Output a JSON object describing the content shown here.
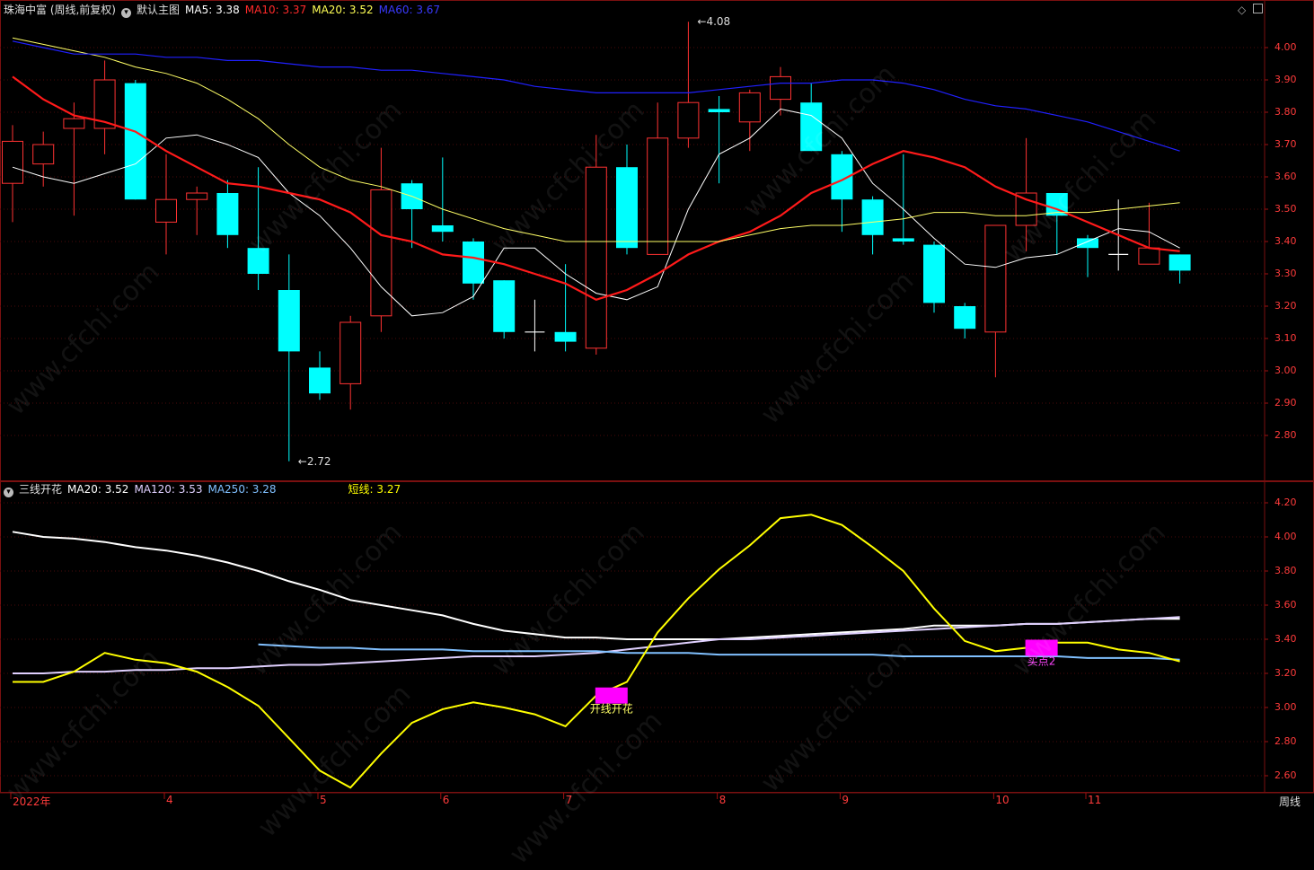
{
  "main_header": {
    "stock": "珠海中富 (周线,前复权)",
    "template": "默认主图",
    "ma5": "MA5: 3.38",
    "ma10": "MA10: 3.37",
    "ma20": "MA20: 3.52",
    "ma60": "MA60: 3.67"
  },
  "sub_header": {
    "name": "三线开花",
    "ma20": "MA20: 3.52",
    "ma120": "MA120: 3.53",
    "ma250": "MA250: 3.28",
    "short": "短线: 3.27"
  },
  "period_label": "周线",
  "colors": {
    "up": "#ff3232",
    "down": "#00ffff",
    "ma5": "#ffffff",
    "ma10": "#ff1a1a",
    "ma20": "#ffff66",
    "ma60": "#2020ff",
    "ind_ma20": "#ffffff",
    "ind_ma120": "#e0d0ff",
    "ind_ma250": "#80c0ff",
    "short": "#ffff00",
    "signal": "#ff00ff"
  },
  "watermark": "www.cfchi.com",
  "chart_data": [
    {
      "type": "candlestick",
      "title": "珠海中富 (周线,前复权)",
      "ylim": [
        2.65,
        4.15
      ],
      "yticks": [
        4.0,
        3.9,
        3.8,
        3.7,
        3.6,
        3.5,
        3.4,
        3.3,
        3.2,
        3.1,
        3.0,
        2.9,
        2.8
      ],
      "max_label": "4.08",
      "min_label": "2.72",
      "candles": [
        {
          "o": 3.58,
          "c": 3.71,
          "h": 3.76,
          "l": 3.46
        },
        {
          "o": 3.64,
          "c": 3.7,
          "h": 3.74,
          "l": 3.57
        },
        {
          "o": 3.75,
          "c": 3.78,
          "h": 3.83,
          "l": 3.48
        },
        {
          "o": 3.75,
          "c": 3.9,
          "h": 3.96,
          "l": 3.67
        },
        {
          "o": 3.89,
          "c": 3.53,
          "h": 3.9,
          "l": 3.53
        },
        {
          "o": 3.46,
          "c": 3.53,
          "h": 3.67,
          "l": 3.36
        },
        {
          "o": 3.53,
          "c": 3.55,
          "h": 3.57,
          "l": 3.42
        },
        {
          "o": 3.55,
          "c": 3.42,
          "h": 3.59,
          "l": 3.38
        },
        {
          "o": 3.38,
          "c": 3.3,
          "h": 3.63,
          "l": 3.25
        },
        {
          "o": 3.25,
          "c": 3.06,
          "h": 3.36,
          "l": 2.72
        },
        {
          "o": 3.01,
          "c": 2.93,
          "h": 3.06,
          "l": 2.91
        },
        {
          "o": 2.96,
          "c": 3.15,
          "h": 3.17,
          "l": 2.88
        },
        {
          "o": 3.17,
          "c": 3.56,
          "h": 3.69,
          "l": 3.12
        },
        {
          "o": 3.58,
          "c": 3.5,
          "h": 3.59,
          "l": 3.38
        },
        {
          "o": 3.45,
          "c": 3.43,
          "h": 3.66,
          "l": 3.4
        },
        {
          "o": 3.4,
          "c": 3.27,
          "h": 3.41,
          "l": 3.22
        },
        {
          "o": 3.28,
          "c": 3.12,
          "h": 3.28,
          "l": 3.1
        },
        {
          "o": 3.12,
          "c": 3.12,
          "h": 3.22,
          "l": 3.06
        },
        {
          "o": 3.12,
          "c": 3.09,
          "h": 3.33,
          "l": 3.06
        },
        {
          "o": 3.07,
          "c": 3.63,
          "h": 3.73,
          "l": 3.05
        },
        {
          "o": 3.63,
          "c": 3.38,
          "h": 3.7,
          "l": 3.36
        },
        {
          "o": 3.36,
          "c": 3.72,
          "h": 3.83,
          "l": 3.36
        },
        {
          "o": 3.72,
          "c": 3.83,
          "h": 4.08,
          "l": 3.69
        },
        {
          "o": 3.81,
          "c": 3.8,
          "h": 3.85,
          "l": 3.58
        },
        {
          "o": 3.77,
          "c": 3.86,
          "h": 3.87,
          "l": 3.68
        },
        {
          "o": 3.84,
          "c": 3.91,
          "h": 3.94,
          "l": 3.79
        },
        {
          "o": 3.83,
          "c": 3.68,
          "h": 3.89,
          "l": 3.68
        },
        {
          "o": 3.67,
          "c": 3.53,
          "h": 3.68,
          "l": 3.43
        },
        {
          "o": 3.53,
          "c": 3.42,
          "h": 3.54,
          "l": 3.36
        },
        {
          "o": 3.41,
          "c": 3.4,
          "h": 3.67,
          "l": 3.39
        },
        {
          "o": 3.39,
          "c": 3.21,
          "h": 3.4,
          "l": 3.18
        },
        {
          "o": 3.2,
          "c": 3.13,
          "h": 3.21,
          "l": 3.1
        },
        {
          "o": 3.12,
          "c": 3.45,
          "h": 3.45,
          "l": 2.98
        },
        {
          "o": 3.45,
          "c": 3.55,
          "h": 3.72,
          "l": 3.37
        },
        {
          "o": 3.55,
          "c": 3.48,
          "h": 3.55,
          "l": 3.36
        },
        {
          "o": 3.41,
          "c": 3.38,
          "h": 3.42,
          "l": 3.29
        },
        {
          "o": 3.36,
          "c": 3.36,
          "h": 3.53,
          "l": 3.31
        },
        {
          "o": 3.33,
          "c": 3.38,
          "h": 3.52,
          "l": 3.33
        },
        {
          "o": 3.36,
          "c": 3.31,
          "h": 3.36,
          "l": 3.27
        }
      ],
      "series": [
        {
          "name": "MA5",
          "values": [
            3.63,
            3.6,
            3.58,
            3.61,
            3.64,
            3.72,
            3.73,
            3.7,
            3.66,
            3.55,
            3.48,
            3.38,
            3.26,
            3.17,
            3.18,
            3.23,
            3.38,
            3.38,
            3.3,
            3.24,
            3.22,
            3.26,
            3.5,
            3.67,
            3.72,
            3.81,
            3.79,
            3.72,
            3.58,
            3.5,
            3.41,
            3.33,
            3.32,
            3.35,
            3.36,
            3.4,
            3.44,
            3.43,
            3.38
          ]
        },
        {
          "name": "MA10",
          "values": [
            3.91,
            3.84,
            3.79,
            3.77,
            3.74,
            3.68,
            3.63,
            3.58,
            3.57,
            3.55,
            3.53,
            3.49,
            3.42,
            3.4,
            3.36,
            3.35,
            3.33,
            3.3,
            3.27,
            3.22,
            3.25,
            3.3,
            3.36,
            3.4,
            3.43,
            3.48,
            3.55,
            3.59,
            3.64,
            3.68,
            3.66,
            3.63,
            3.57,
            3.53,
            3.5,
            3.46,
            3.42,
            3.38,
            3.37
          ]
        },
        {
          "name": "MA20",
          "values": [
            4.03,
            4.01,
            3.99,
            3.97,
            3.94,
            3.92,
            3.89,
            3.84,
            3.78,
            3.7,
            3.63,
            3.59,
            3.57,
            3.54,
            3.5,
            3.47,
            3.44,
            3.42,
            3.4,
            3.4,
            3.4,
            3.4,
            3.4,
            3.4,
            3.42,
            3.44,
            3.45,
            3.45,
            3.46,
            3.47,
            3.49,
            3.49,
            3.48,
            3.48,
            3.49,
            3.49,
            3.5,
            3.51,
            3.52
          ]
        },
        {
          "name": "MA60",
          "values": [
            4.02,
            4.0,
            3.98,
            3.98,
            3.98,
            3.97,
            3.97,
            3.96,
            3.96,
            3.95,
            3.94,
            3.94,
            3.93,
            3.93,
            3.92,
            3.91,
            3.9,
            3.88,
            3.87,
            3.86,
            3.86,
            3.86,
            3.86,
            3.87,
            3.88,
            3.89,
            3.89,
            3.9,
            3.9,
            3.89,
            3.87,
            3.84,
            3.82,
            3.81,
            3.79,
            3.77,
            3.74,
            3.71,
            3.68
          ]
        }
      ]
    },
    {
      "type": "line",
      "title": "三线开花",
      "ylim": [
        2.52,
        4.3
      ],
      "yticks": [
        4.2,
        4.0,
        3.8,
        3.6,
        3.4,
        3.2,
        3.0,
        2.8,
        2.6
      ],
      "x_labels": [
        {
          "label": "2022年",
          "index": 0
        },
        {
          "label": "4",
          "index": 5
        },
        {
          "label": "5",
          "index": 10
        },
        {
          "label": "6",
          "index": 14
        },
        {
          "label": "7",
          "index": 18
        },
        {
          "label": "8",
          "index": 23
        },
        {
          "label": "9",
          "index": 27
        },
        {
          "label": "10",
          "index": 32
        },
        {
          "label": "11",
          "index": 35
        }
      ],
      "series": [
        {
          "name": "MA20",
          "values": [
            4.03,
            4.0,
            3.99,
            3.97,
            3.94,
            3.92,
            3.89,
            3.85,
            3.8,
            3.74,
            3.69,
            3.63,
            3.6,
            3.57,
            3.54,
            3.49,
            3.45,
            3.43,
            3.41,
            3.41,
            3.4,
            3.4,
            3.4,
            3.4,
            3.41,
            3.42,
            3.43,
            3.44,
            3.45,
            3.46,
            3.48,
            3.48,
            3.48,
            3.49,
            3.49,
            3.5,
            3.51,
            3.52,
            3.52
          ]
        },
        {
          "name": "MA120",
          "values": [
            3.2,
            3.2,
            3.21,
            3.21,
            3.22,
            3.22,
            3.23,
            3.23,
            3.24,
            3.25,
            3.25,
            3.26,
            3.27,
            3.28,
            3.29,
            3.3,
            3.3,
            3.3,
            3.31,
            3.32,
            3.34,
            3.36,
            3.38,
            3.4,
            3.4,
            3.41,
            3.42,
            3.43,
            3.44,
            3.45,
            3.46,
            3.47,
            3.48,
            3.49,
            3.49,
            3.5,
            3.51,
            3.52,
            3.53
          ]
        },
        {
          "name": "MA250",
          "values": [
            null,
            null,
            null,
            null,
            null,
            null,
            null,
            null,
            3.37,
            3.36,
            3.35,
            3.35,
            3.34,
            3.34,
            3.34,
            3.33,
            3.33,
            3.33,
            3.33,
            3.33,
            3.32,
            3.32,
            3.32,
            3.31,
            3.31,
            3.31,
            3.31,
            3.31,
            3.31,
            3.3,
            3.3,
            3.3,
            3.3,
            3.3,
            3.3,
            3.29,
            3.29,
            3.29,
            3.28
          ]
        },
        {
          "name": "短线",
          "values": [
            3.15,
            3.15,
            3.21,
            3.32,
            3.28,
            3.26,
            3.21,
            3.12,
            3.01,
            2.82,
            2.63,
            2.53,
            2.73,
            2.91,
            2.99,
            3.03,
            3.0,
            2.96,
            2.89,
            3.07,
            3.15,
            3.44,
            3.64,
            3.81,
            3.95,
            4.11,
            4.13,
            4.07,
            3.94,
            3.8,
            3.58,
            3.39,
            3.33,
            3.35,
            3.38,
            3.38,
            3.34,
            3.32,
            3.27
          ]
        }
      ],
      "signals": [
        {
          "label": "开线开花",
          "index": 19
        },
        {
          "label": "买点2",
          "index": 33
        }
      ]
    }
  ]
}
